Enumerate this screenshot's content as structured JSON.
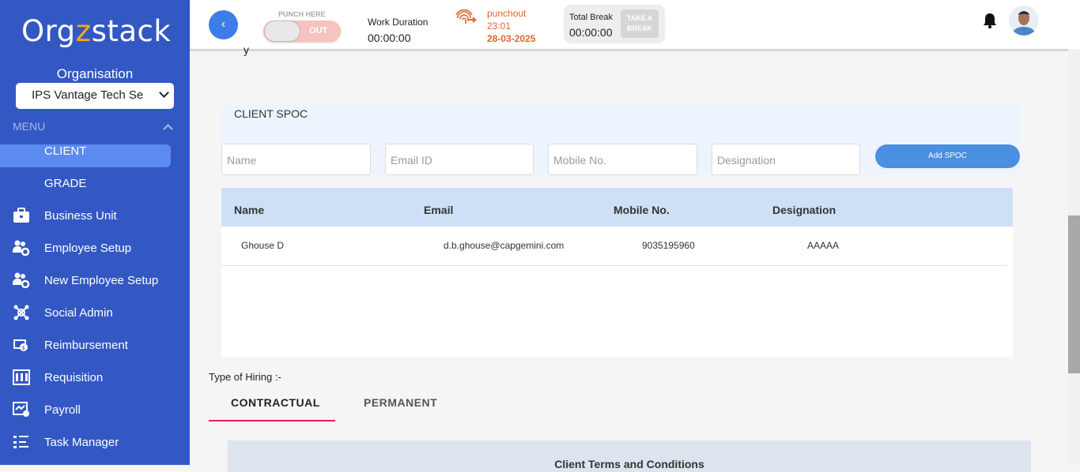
{
  "sidebar": {
    "logo": {
      "part1": "Org",
      "part2": "z",
      "part3": "stack"
    },
    "organisation_label": "Organisation",
    "organisation_selected": "IPS Vantage Tech Se",
    "menu_label": "MENU",
    "items": [
      {
        "label": "CLIENT",
        "icon": "",
        "active": true
      },
      {
        "label": "GRADE",
        "icon": ""
      },
      {
        "label": "Business Unit",
        "icon": "briefcase-icon"
      },
      {
        "label": "Employee Setup",
        "icon": "users-gear-icon"
      },
      {
        "label": "New Employee Setup",
        "icon": "users-gear-icon"
      },
      {
        "label": "Social Admin",
        "icon": "social-admin-icon"
      },
      {
        "label": "Reimbursement",
        "icon": "reimbursement-icon"
      },
      {
        "label": "Requisition",
        "icon": "requisition-icon"
      },
      {
        "label": "Payroll",
        "icon": "payroll-icon"
      },
      {
        "label": "Task Manager",
        "icon": "task-list-icon"
      }
    ]
  },
  "header": {
    "back_icon": "‹",
    "punch_here": "PUNCH HERE",
    "punch_state": "OUT",
    "work_duration_label": "Work Duration",
    "work_duration_value": "00:00:00",
    "punchout_label": "punchout",
    "punchout_time": "23:01",
    "punchout_date": "28-03-2025",
    "total_break_label": "Total Break",
    "total_break_value": "00:00:00",
    "take_break_line1": "TAKE A",
    "take_break_line2": "BREAK",
    "colors": {
      "accent": "#3d7de8",
      "punch": "#e0662e"
    }
  },
  "main": {
    "stray_text": "y",
    "client_spoc": {
      "title": "CLIENT SPOC",
      "name_placeholder": "Name",
      "email_placeholder": "Email ID",
      "mobile_placeholder": "Mobile No.",
      "designation_placeholder": "Designation",
      "add_button": "Add SPOC"
    },
    "table": {
      "headers": [
        "Name",
        "Email",
        "Mobile No.",
        "Designation"
      ],
      "rows": [
        [
          "Ghouse D",
          "d.b.ghouse@capgemini.com",
          "9035195960",
          "AAAAA"
        ]
      ]
    },
    "type_of_hiring_label": "Type of Hiring :-",
    "tabs": [
      {
        "label": "CONTRACTUAL",
        "active": true
      },
      {
        "label": "PERMANENT",
        "active": false
      }
    ],
    "terms_title": "Client Terms and Conditions"
  }
}
